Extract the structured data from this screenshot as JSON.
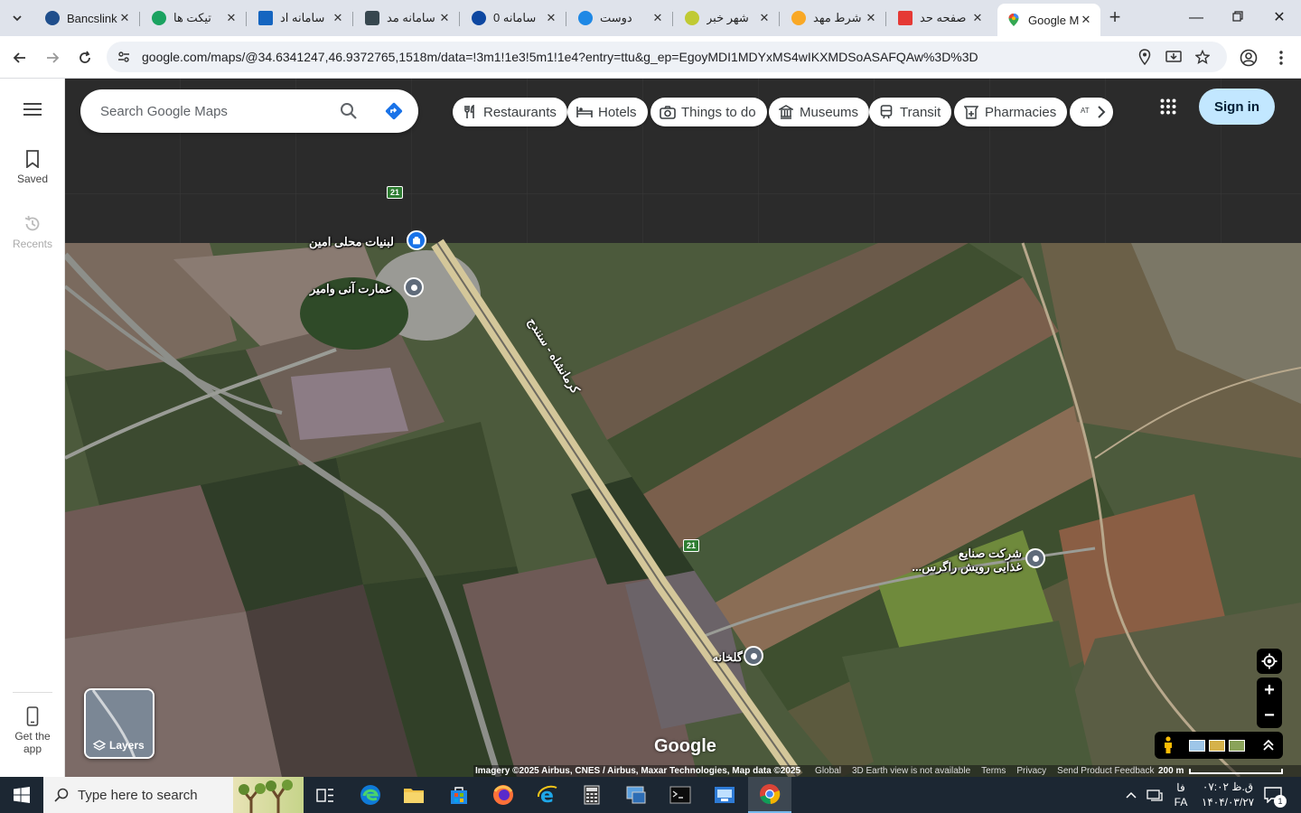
{
  "browser": {
    "tabs": [
      {
        "title": "Bancslink",
        "favicon_color": "#1f4e8c"
      },
      {
        "title": "تیکت ها",
        "favicon_color": "#1aa260"
      },
      {
        "title": "سامانه اد",
        "favicon_color": "#1565c0"
      },
      {
        "title": "سامانه مد",
        "favicon_color": "#37474f"
      },
      {
        "title": "سامانه 0",
        "favicon_color": "#0d47a1"
      },
      {
        "title": "دوست",
        "favicon_color": "#1e88e5"
      },
      {
        "title": "شهر خبر",
        "favicon_color": "#c0ca33"
      },
      {
        "title": "شرط مهد",
        "favicon_color": "#f9a825"
      },
      {
        "title": "صفحه حد",
        "favicon_color": "#e53935"
      },
      {
        "title": "Google M",
        "favicon_color": "#34a853"
      }
    ],
    "active_tab_index": 9,
    "url": "google.com/maps/@34.6341247,46.9372765,1518m/data=!3m1!1e3!5m1!1e4?entry=ttu&g_ep=EgoyMDI1MDYxMS4wIKXMDSoASAFQAw%3D%3D"
  },
  "rail": {
    "saved": "Saved",
    "recents": "Recents",
    "get_app_line1": "Get the",
    "get_app_line2": "app"
  },
  "search": {
    "placeholder": "Search Google Maps"
  },
  "chips": [
    {
      "label": "Restaurants",
      "icon": "fork-knife-icon"
    },
    {
      "label": "Hotels",
      "icon": "bed-icon"
    },
    {
      "label": "Things to do",
      "icon": "camera-icon"
    },
    {
      "label": "Museums",
      "icon": "museum-icon"
    },
    {
      "label": "Transit",
      "icon": "train-icon"
    },
    {
      "label": "Pharmacies",
      "icon": "pharmacy-icon"
    }
  ],
  "chip_partial": "AT",
  "signin": "Sign in",
  "map": {
    "places": [
      {
        "name": "لبنیات محلی امین"
      },
      {
        "name": "عمارت آنی وامیر"
      },
      {
        "name": "شرکت صنایع",
        "name2": "غذایی رویش راگرس..."
      },
      {
        "name": "گلخانه"
      }
    ],
    "road_name": "کرمانشاه - سنندج",
    "road_shield": "21",
    "road_shield_2": "21",
    "layers_label": "Layers",
    "logo": "Google"
  },
  "footer": {
    "imagery": "Imagery ©2025 Airbus, CNES / Airbus, Maxar Technologies, Map data ©2025",
    "links": [
      "Global",
      "3D Earth view is not available",
      "Terms",
      "Privacy",
      "Send Product Feedback"
    ],
    "scale": "200 m"
  },
  "taskbar": {
    "search_hint": "Type here to search",
    "lang_top": "فا",
    "lang_bottom": "FA",
    "time": "ق.ظ ۰۷:۰۲",
    "date": "۱۴۰۴/۰۳/۲۷",
    "notifications": "1"
  }
}
